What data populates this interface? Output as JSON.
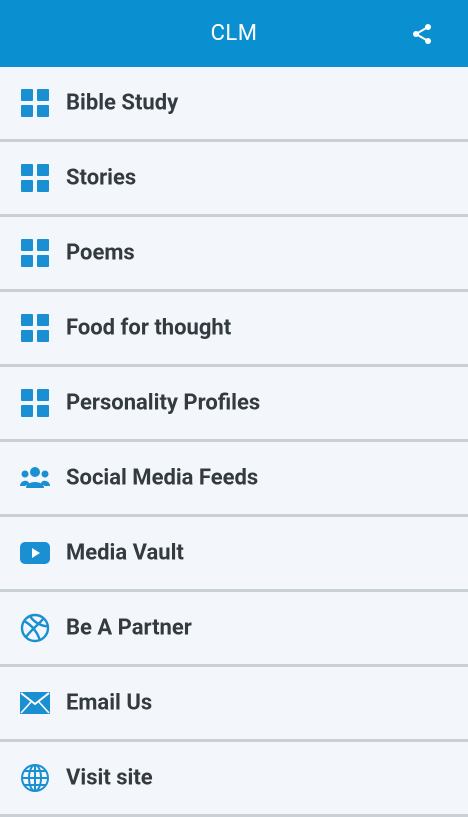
{
  "app_bar": {
    "title": "CLM",
    "share_icon": "share-icon",
    "color": "#0a8fd0"
  },
  "menu": {
    "items": [
      {
        "label": "Bible Study",
        "icon": "grid-icon"
      },
      {
        "label": "Stories",
        "icon": "grid-icon"
      },
      {
        "label": "Poems",
        "icon": "grid-icon"
      },
      {
        "label": "Food for thought",
        "icon": "grid-icon"
      },
      {
        "label": "Personality Profiles",
        "icon": "grid-icon"
      },
      {
        "label": "Social Media Feeds",
        "icon": "users-icon"
      },
      {
        "label": "Media Vault",
        "icon": "youtube-icon"
      },
      {
        "label": "Be A Partner",
        "icon": "basketball-icon"
      },
      {
        "label": "Email Us",
        "icon": "envelope-icon"
      },
      {
        "label": "Visit site",
        "icon": "globe-icon"
      }
    ]
  },
  "colors": {
    "icon": "#1a8fd1",
    "label": "#333a40",
    "row_bg": "#f3f7fb"
  }
}
